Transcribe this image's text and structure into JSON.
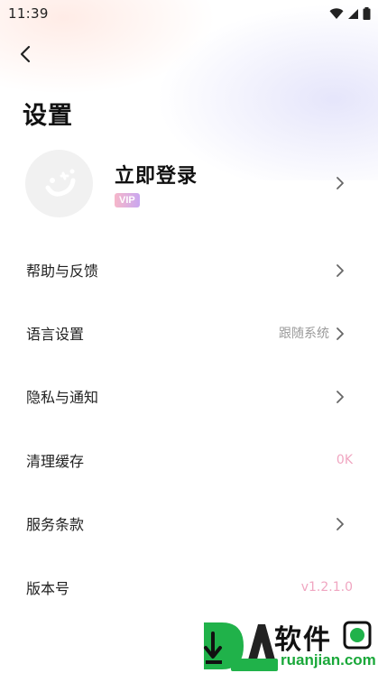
{
  "status_bar": {
    "time": "11:39",
    "icons": [
      "wifi-icon",
      "signal-icon",
      "battery-icon"
    ]
  },
  "header": {
    "back_icon": "chevron-left-icon",
    "title": "设置"
  },
  "account": {
    "login_label": "立即登录",
    "vip_badge": "VIP",
    "avatar_icon": "smiley-avatar-icon"
  },
  "settings": {
    "items": [
      {
        "label": "帮助与反馈",
        "value": "",
        "has_chevron": true
      },
      {
        "label": "语言设置",
        "value": "跟随系统",
        "has_chevron": true
      },
      {
        "label": "隐私与通知",
        "value": "",
        "has_chevron": true
      },
      {
        "label": "清理缓存",
        "value": "0K",
        "has_chevron": false
      },
      {
        "label": "服务条款",
        "value": "",
        "has_chevron": true
      },
      {
        "label": "版本号",
        "value": "v1.2.1.0",
        "has_chevron": false
      }
    ]
  },
  "watermark": {
    "big": "软件",
    "small": "ruanjian.com"
  },
  "colors": {
    "accent_pink": "#f0a6c1",
    "vip_gradient_start": "#f6b7c9",
    "vip_gradient_end": "#c9a7f0",
    "watermark_green": "#1aa83a"
  }
}
